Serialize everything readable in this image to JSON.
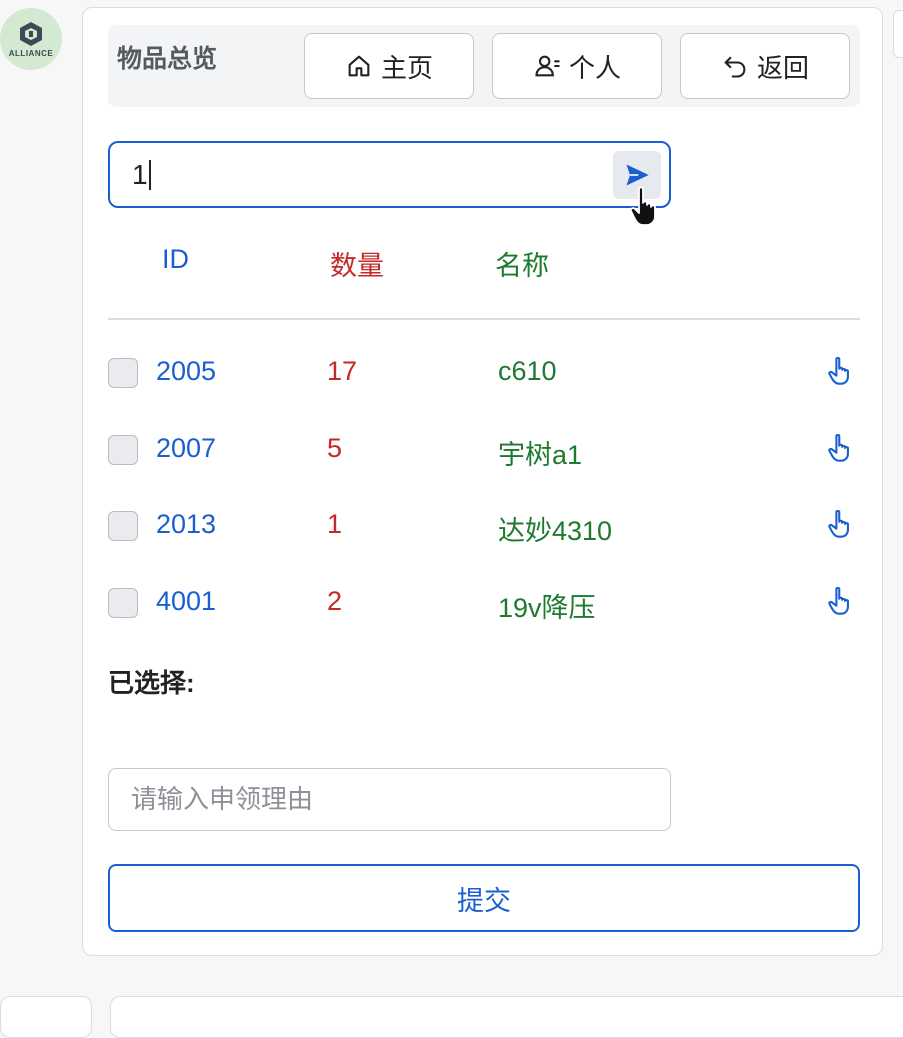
{
  "header": {
    "title": "物品总览",
    "nav": [
      {
        "label": "主页",
        "icon": "home-icon"
      },
      {
        "label": "个人",
        "icon": "user-icon"
      },
      {
        "label": "返回",
        "icon": "undo-icon"
      }
    ]
  },
  "avatar": {
    "text": "ALLIANCE"
  },
  "search": {
    "value": "1",
    "send_icon": "send-icon"
  },
  "table": {
    "columns": [
      "ID",
      "数量",
      "名称"
    ],
    "rows": [
      {
        "id": "2005",
        "qty": "17",
        "name": "c610"
      },
      {
        "id": "2007",
        "qty": "5",
        "name": "宇树a1"
      },
      {
        "id": "2013",
        "qty": "1",
        "name": "达妙4310"
      },
      {
        "id": "4001",
        "qty": "2",
        "name": "19v降压"
      }
    ]
  },
  "selected": {
    "label": "已选择:"
  },
  "reason": {
    "placeholder": "请输入申领理由",
    "value": ""
  },
  "submit": {
    "label": "提交"
  },
  "colors": {
    "accent": "#1a5fd1",
    "qty": "#c62828",
    "name": "#1e7a2e"
  }
}
